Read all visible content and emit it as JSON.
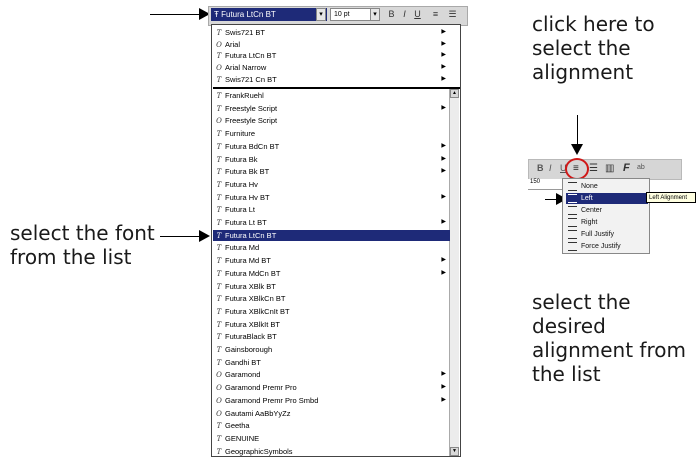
{
  "annotations": {
    "click_here": [
      "click here to",
      "select the",
      "alignment"
    ],
    "select_font": [
      "select the font",
      "from the list"
    ],
    "select_alignment": [
      "select the desired",
      "alignment from",
      "the list"
    ]
  },
  "toolbar": {
    "font_value": "Futura LtCn BT",
    "size_value": "10 pt",
    "icons": [
      "bold-icon",
      "italic-icon",
      "underline-icon",
      "align-icon",
      "list-icon"
    ]
  },
  "font_list": {
    "recent": [
      {
        "name": "Swis721 BT",
        "icon": "T",
        "sub": true
      },
      {
        "name": "Arial",
        "icon": "O",
        "sub": true
      },
      {
        "name": "Futura LtCn BT",
        "icon": "T",
        "sub": true
      },
      {
        "name": "Arial Narrow",
        "icon": "O",
        "sub": true
      },
      {
        "name": "Swis721 Cn BT",
        "icon": "T",
        "sub": true
      }
    ],
    "items": [
      {
        "name": "FrankRuehl",
        "icon": "T",
        "sub": false
      },
      {
        "name": "Freestyle Script",
        "icon": "T",
        "sub": true
      },
      {
        "name": "Freestyle Script",
        "icon": "O",
        "sub": false
      },
      {
        "name": "Furniture",
        "icon": "T",
        "sub": false
      },
      {
        "name": "Futura BdCn BT",
        "icon": "T",
        "sub": true
      },
      {
        "name": "Futura Bk",
        "icon": "T",
        "sub": true
      },
      {
        "name": "Futura Bk BT",
        "icon": "T",
        "sub": true
      },
      {
        "name": "Futura Hv",
        "icon": "T",
        "sub": false
      },
      {
        "name": "Futura Hv BT",
        "icon": "T",
        "sub": true
      },
      {
        "name": "Futura Lt",
        "icon": "T",
        "sub": false
      },
      {
        "name": "Futura Lt BT",
        "icon": "T",
        "sub": true
      },
      {
        "name": "Futura LtCn BT",
        "icon": "T",
        "sub": false,
        "selected": true
      },
      {
        "name": "Futura Md",
        "icon": "T",
        "sub": false
      },
      {
        "name": "Futura Md BT",
        "icon": "T",
        "sub": true
      },
      {
        "name": "Futura MdCn BT",
        "icon": "T",
        "sub": true
      },
      {
        "name": "Futura XBlk BT",
        "icon": "T",
        "sub": false
      },
      {
        "name": "Futura XBlkCn BT",
        "icon": "T",
        "sub": false
      },
      {
        "name": "Futura XBlkCnIt BT",
        "icon": "T",
        "sub": false
      },
      {
        "name": "Futura XBlkIt BT",
        "icon": "T",
        "sub": false
      },
      {
        "name": "FuturaBlack BT",
        "icon": "T",
        "sub": false
      },
      {
        "name": "Gainsborough",
        "icon": "T",
        "sub": false
      },
      {
        "name": "Gandhi BT",
        "icon": "T",
        "sub": false
      },
      {
        "name": "Garamond",
        "icon": "O",
        "sub": true
      },
      {
        "name": "Garamond Premr Pro",
        "icon": "O",
        "sub": true
      },
      {
        "name": "Garamond Premr Pro Smbd",
        "icon": "O",
        "sub": true
      },
      {
        "name": "Gautami AaBbYyZz",
        "icon": "O",
        "sub": false
      },
      {
        "name": "Geetha",
        "icon": "T",
        "sub": false
      },
      {
        "name": "GENUINE",
        "icon": "T",
        "sub": false
      },
      {
        "name": "GeographicSymbols",
        "icon": "T",
        "sub": false
      }
    ]
  },
  "alignment": {
    "tooltip": "Left Alignment",
    "ruler": "150",
    "options": [
      {
        "label": "None"
      },
      {
        "label": "Left",
        "selected": true
      },
      {
        "label": "Center"
      },
      {
        "label": "Right"
      },
      {
        "label": "Full Justify"
      },
      {
        "label": "Force Justify"
      }
    ]
  }
}
